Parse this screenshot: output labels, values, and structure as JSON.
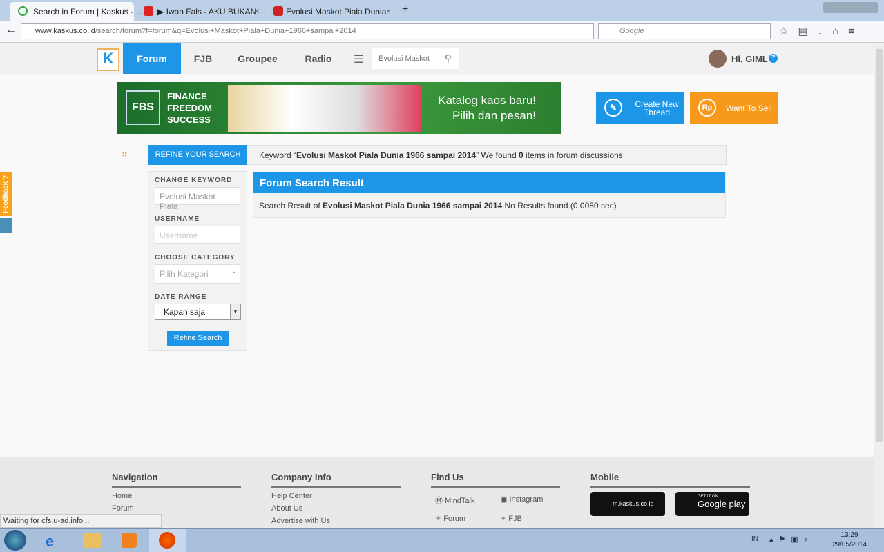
{
  "browser": {
    "tabs": [
      {
        "label": "Search in Forum | Kaskus - ...",
        "icon": "loading-icon"
      },
      {
        "label": "▶ Iwan Fals - AKU BUKAN ...",
        "icon": "youtube-icon"
      },
      {
        "label": "Evolusi Maskot Piala Dunia...",
        "icon": "s-icon"
      }
    ],
    "url_domain": "www.kaskus.co.id",
    "url_path": "/search/forum?f=forum&q=Evolusi+Maskot+Piala+Dunia+1966+sampai+2014",
    "search_placeholder": "Google",
    "status": "Waiting for cfs.u-ad.info..."
  },
  "site": {
    "nav": [
      "Forum",
      "FJB",
      "Groupee",
      "Radio"
    ],
    "search_value": "Evolusi Maskot",
    "user": "Hi, GIML",
    "banner": {
      "brand": "FBS",
      "tagline": "FINANCE FREEDOM SUCCESS",
      "text1": "Katalog kaos baru!",
      "text2": "Pilih dan pesan!"
    },
    "create_thread": "Create New Thread",
    "want_to_sell": "Want To Sell",
    "feedback": "Feedback ?"
  },
  "search": {
    "refine_tab": "REFINE YOUR SEARCH",
    "kw_prefix": "Keyword “",
    "keyword": "Evolusi Maskot Piala Dunia 1966 sampai 2014",
    "kw_mid": "” We found ",
    "count": "0",
    "kw_suffix": " items in forum discussions",
    "change_keyword": "CHANGE KEYWORD",
    "keyword_value": "Evolusi Maskot Piala",
    "username": "USERNAME",
    "username_placeholder": "Username",
    "category": "CHOOSE CATEGORY",
    "category_value": "Pilih Kategori",
    "date_range": "DATE RANGE",
    "date_value": "Kapan saja",
    "refine_button": "Refine Search",
    "result_title": "Forum Search Result",
    "res_prefix": "Search Result of ",
    "res_suffix": " No Results found (0.0080 sec)"
  },
  "footer": {
    "navigation": {
      "title": "Navigation",
      "links": [
        "Home",
        "Forum"
      ]
    },
    "company": {
      "title": "Company Info",
      "links": [
        "Help Center",
        "About Us",
        "Advertise with Us"
      ]
    },
    "find": {
      "title": "Find Us",
      "links": [
        "MindTalk",
        "Instagram",
        "Forum",
        "FJB"
      ]
    },
    "mobile": {
      "title": "Mobile",
      "mkaskus": "m.kaskus.co.id",
      "gp_small": "GET IT ON",
      "gp": "Google play"
    }
  },
  "taskbar": {
    "lang": "IN",
    "time": "13:29",
    "date": "29/05/2014"
  },
  "colors": {
    "accent": "#1e96e8",
    "orange": "#f79a1c"
  }
}
